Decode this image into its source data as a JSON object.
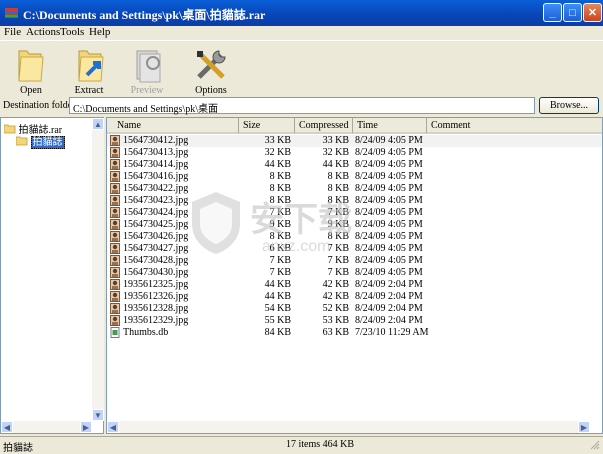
{
  "window": {
    "title": "C:\\Documents and Settings\\pk\\桌面\\拍貓誌.rar",
    "minimize": "_",
    "maximize": "□",
    "close": "✕"
  },
  "menu": [
    "File",
    "Actions",
    "Tools",
    "Help"
  ],
  "toolbar": {
    "open": "Open",
    "extract": "Extract",
    "preview": "Preview",
    "options": "Options"
  },
  "destination": {
    "label": "Destination folder:",
    "value": "C:\\Documents and Settings\\pk\\桌面",
    "browse": "Browse..."
  },
  "tree": {
    "root": "拍貓誌.rar",
    "child": "拍貓誌"
  },
  "columns": [
    "Name",
    "Size",
    "Compressed",
    "Time",
    "Comment"
  ],
  "files": [
    {
      "name": "1564730412.jpg",
      "size": "33 KB",
      "compressed": "33 KB",
      "time": "8/24/09 4:05 PM",
      "icon": "image-icon"
    },
    {
      "name": "1564730413.jpg",
      "size": "32 KB",
      "compressed": "32 KB",
      "time": "8/24/09 4:05 PM",
      "icon": "image-icon"
    },
    {
      "name": "1564730414.jpg",
      "size": "44 KB",
      "compressed": "44 KB",
      "time": "8/24/09 4:05 PM",
      "icon": "image-icon"
    },
    {
      "name": "1564730416.jpg",
      "size": "8 KB",
      "compressed": "8 KB",
      "time": "8/24/09 4:05 PM",
      "icon": "image-icon"
    },
    {
      "name": "1564730422.jpg",
      "size": "8 KB",
      "compressed": "8 KB",
      "time": "8/24/09 4:05 PM",
      "icon": "image-icon"
    },
    {
      "name": "1564730423.jpg",
      "size": "8 KB",
      "compressed": "8 KB",
      "time": "8/24/09 4:05 PM",
      "icon": "image-icon"
    },
    {
      "name": "1564730424.jpg",
      "size": "7 KB",
      "compressed": "7 KB",
      "time": "8/24/09 4:05 PM",
      "icon": "image-icon"
    },
    {
      "name": "1564730425.jpg",
      "size": "9 KB",
      "compressed": "9 KB",
      "time": "8/24/09 4:05 PM",
      "icon": "image-icon"
    },
    {
      "name": "1564730426.jpg",
      "size": "8 KB",
      "compressed": "8 KB",
      "time": "8/24/09 4:05 PM",
      "icon": "image-icon"
    },
    {
      "name": "1564730427.jpg",
      "size": "6 KB",
      "compressed": "7 KB",
      "time": "8/24/09 4:05 PM",
      "icon": "image-icon"
    },
    {
      "name": "1564730428.jpg",
      "size": "7 KB",
      "compressed": "7 KB",
      "time": "8/24/09 4:05 PM",
      "icon": "image-icon"
    },
    {
      "name": "1564730430.jpg",
      "size": "7 KB",
      "compressed": "7 KB",
      "time": "8/24/09 4:05 PM",
      "icon": "image-icon"
    },
    {
      "name": "1935612325.jpg",
      "size": "44 KB",
      "compressed": "42 KB",
      "time": "8/24/09 2:04 PM",
      "icon": "image-icon"
    },
    {
      "name": "1935612326.jpg",
      "size": "44 KB",
      "compressed": "42 KB",
      "time": "8/24/09 2:04 PM",
      "icon": "image-icon"
    },
    {
      "name": "1935612328.jpg",
      "size": "54 KB",
      "compressed": "52 KB",
      "time": "8/24/09 2:04 PM",
      "icon": "image-icon"
    },
    {
      "name": "1935612329.jpg",
      "size": "55 KB",
      "compressed": "53 KB",
      "time": "8/24/09 2:04 PM",
      "icon": "image-icon"
    },
    {
      "name": "Thumbs.db",
      "size": "84 KB",
      "compressed": "63 KB",
      "time": "7/23/10 11:29 AM",
      "icon": "db-file-icon"
    }
  ],
  "status": {
    "left": "拍貓誌",
    "center": "17 items 464 KB"
  },
  "watermark": {
    "text": "安下载",
    "sub": "anxz.com"
  },
  "colors": {
    "title_bar": "#0a5fd8",
    "selection": "#316ac5",
    "window_bg": "#ece9d8"
  }
}
